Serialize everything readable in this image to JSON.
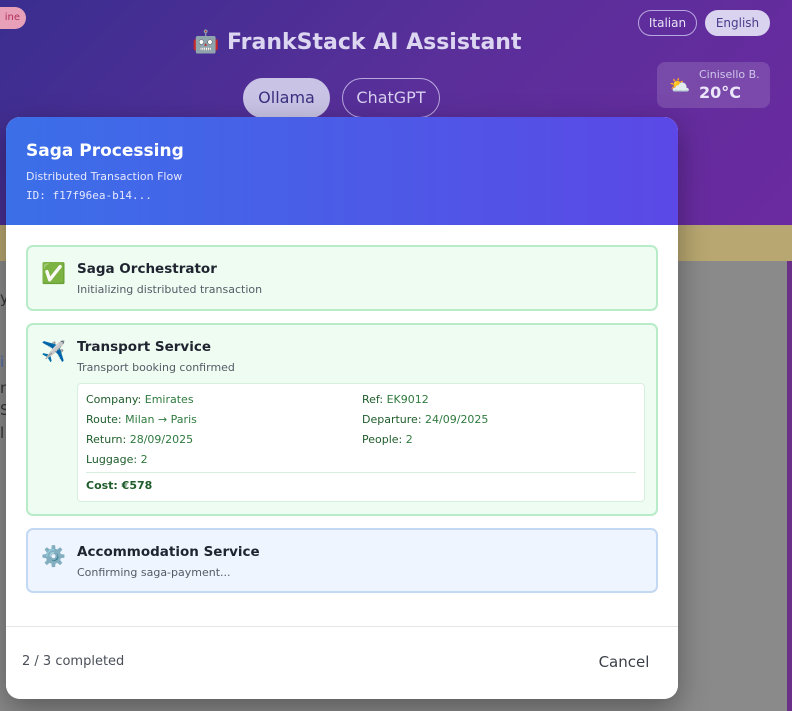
{
  "header": {
    "status_pill": "ine",
    "title": "🤖 FrankStack AI Assistant",
    "languages": [
      "Italian",
      "English"
    ],
    "providers": [
      "Ollama",
      "ChatGPT"
    ],
    "weather": {
      "icon": "⛅",
      "city": "Cinisello B.",
      "temp": "20°C"
    }
  },
  "body_fragments": [
    "y",
    "i",
    "n",
    "S",
    "l"
  ],
  "modal": {
    "title": "Saga Processing",
    "subtitle": "Distributed Transaction Flow",
    "id": "ID: f17f96ea-b14...",
    "steps": [
      {
        "icon": "✅",
        "name": "Saga Orchestrator",
        "desc": "Initializing distributed transaction",
        "status": "completed"
      },
      {
        "icon": "✈️",
        "name": "Transport Service",
        "desc": "Transport booking confirmed",
        "status": "completed",
        "details": {
          "company_key": "Company:",
          "company": "Emirates",
          "ref_key": "Ref:",
          "ref": "EK9012",
          "route_key": "Route:",
          "route": "Milan → Paris",
          "departure_key": "Departure:",
          "departure": "24/09/2025",
          "return_key": "Return:",
          "return": "28/09/2025",
          "people_key": "People:",
          "people": "2",
          "luggage_key": "Luggage:",
          "luggage": "2",
          "cost": "Cost: €578"
        }
      },
      {
        "icon": "⚙️",
        "name": "Accommodation Service",
        "desc": "Confirming saga-payment...",
        "status": "in-progress"
      }
    ],
    "progress": "2 / 3 completed",
    "cancel": "Cancel"
  },
  "colors": {
    "modal_header_start": "#3b6fe8",
    "modal_header_end": "#5b48e6",
    "success_bg": "#effcf2",
    "pending_bg": "#eef5fe"
  }
}
